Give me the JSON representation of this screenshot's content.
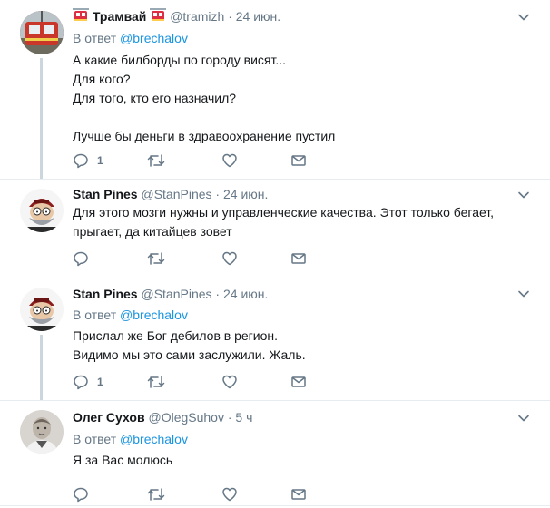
{
  "tweets": [
    {
      "name": "Трамвай",
      "handle": "@tramizh",
      "dot": "·",
      "time": "24 июн.",
      "reply_prefix": "В ответ",
      "reply_mention": "@brechalov",
      "lines": [
        "А какие билборды по городу висят...",
        "Для кого?",
        "Для того, кто его назначил?",
        "",
        "Лучше бы деньги в здравоохранение пустил"
      ],
      "reply_count": "1"
    },
    {
      "name": "Stan Pines",
      "handle": "@StanPines",
      "dot": "·",
      "time": "24 июн.",
      "lines": [
        "Для этого мозги нужны и управленческие качества. Этот только бегает,",
        "прыгает, да китайцев зовет"
      ],
      "reply_count": ""
    },
    {
      "name": "Stan Pines",
      "handle": "@StanPines",
      "dot": "·",
      "time": "24 июн.",
      "reply_prefix": "В ответ",
      "reply_mention": "@brechalov",
      "lines": [
        "Прислал же Бог дебилов в регион.",
        "Видимо мы это сами заслужили. Жаль."
      ],
      "reply_count": "1"
    },
    {
      "name": "Олег Сухов",
      "handle": "@OlegSuhov",
      "dot": "·",
      "time": "5 ч",
      "reply_prefix": "В ответ",
      "reply_mention": "@brechalov",
      "lines": [
        "Я за Вас молюсь"
      ],
      "reply_count": ""
    }
  ],
  "icons": {
    "reply": "reply-icon",
    "retweet": "retweet-icon",
    "like": "heart-icon",
    "dm": "envelope-icon",
    "menu": "chevron-down-icon",
    "tram": "tram-emoji-icon"
  },
  "colors": {
    "name": "#14171a",
    "secondary": "#657786",
    "mention": "#1b95e0",
    "divider": "#e6ecf0",
    "thread_line": "#ccd6dd",
    "tram_red": "#dd2e44"
  }
}
